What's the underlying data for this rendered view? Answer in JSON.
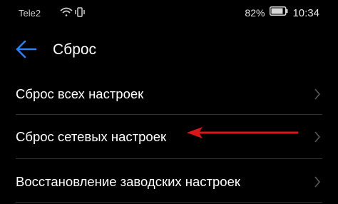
{
  "status_bar": {
    "carrier": "Tele2",
    "battery_percent": "82%",
    "time": "10:34"
  },
  "header": {
    "title": "Сброс"
  },
  "items": [
    {
      "label": "Сброс всех настроек"
    },
    {
      "label": "Сброс сетевых настроек"
    },
    {
      "label": "Восстановление заводских настроек"
    }
  ],
  "colors": {
    "background": "#000000",
    "accent": "#2f7ff5",
    "annotation_arrow": "#d8161b"
  }
}
